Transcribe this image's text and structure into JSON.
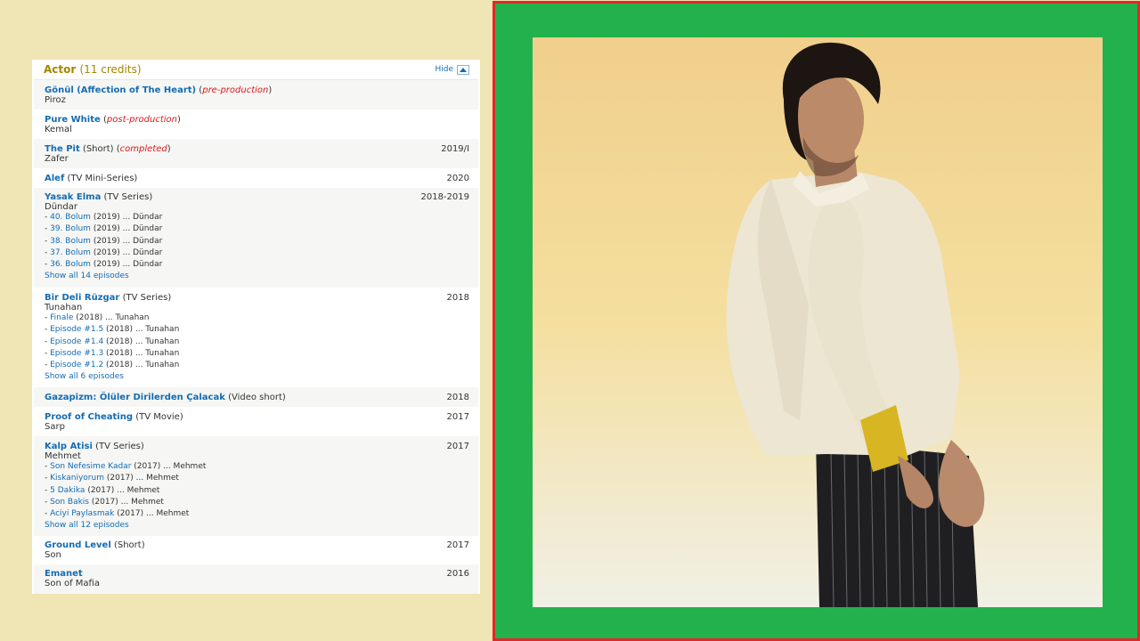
{
  "header": {
    "title": "Actor",
    "count": "(11 credits)",
    "hide_label": "Hide"
  },
  "credits": [
    {
      "title": "Gönül (Affection of The Heart)",
      "type": "",
      "status": "pre-production",
      "year": "",
      "role": "Piroz",
      "episodes": [],
      "show_all": ""
    },
    {
      "title": "Pure White",
      "type": "",
      "status": "post-production",
      "year": "",
      "role": "Kemal",
      "episodes": [],
      "show_all": ""
    },
    {
      "title": "The Pit",
      "type": "(Short)",
      "status": "completed",
      "year": "2019/I",
      "role": "Zafer",
      "episodes": [],
      "show_all": ""
    },
    {
      "title": "Alef",
      "type": "(TV Mini-Series)",
      "status": "",
      "year": "2020",
      "role": "",
      "episodes": [],
      "show_all": ""
    },
    {
      "title": "Yasak Elma",
      "type": "(TV Series)",
      "status": "",
      "year": "2018-2019",
      "role": "Dündar",
      "episodes": [
        {
          "name": "40. Bolum",
          "year": "(2019)",
          "role": "... Dündar"
        },
        {
          "name": "39. Bolum",
          "year": "(2019)",
          "role": "... Dündar"
        },
        {
          "name": "38. Bolum",
          "year": "(2019)",
          "role": "... Dündar"
        },
        {
          "name": "37. Bolum",
          "year": "(2019)",
          "role": "... Dündar"
        },
        {
          "name": "36. Bolum",
          "year": "(2019)",
          "role": "... Dündar"
        }
      ],
      "show_all": "Show all 14 episodes"
    },
    {
      "title": "Bir Deli Rüzgar",
      "type": "(TV Series)",
      "status": "",
      "year": "2018",
      "role": "Tunahan",
      "episodes": [
        {
          "name": "Finale",
          "year": "(2018)",
          "role": "... Tunahan"
        },
        {
          "name": "Episode #1.5",
          "year": "(2018)",
          "role": "... Tunahan"
        },
        {
          "name": "Episode #1.4",
          "year": "(2018)",
          "role": "... Tunahan"
        },
        {
          "name": "Episode #1.3",
          "year": "(2018)",
          "role": "... Tunahan"
        },
        {
          "name": "Episode #1.2",
          "year": "(2018)",
          "role": "... Tunahan"
        }
      ],
      "show_all": "Show all 6 episodes"
    },
    {
      "title": "Gazapizm: Ölüler Dirilerden Çalacak",
      "type": "(Video short)",
      "status": "",
      "year": "2018",
      "role": "",
      "episodes": [],
      "show_all": ""
    },
    {
      "title": "Proof of Cheating",
      "type": "(TV Movie)",
      "status": "",
      "year": "2017",
      "role": "Sarp",
      "episodes": [],
      "show_all": ""
    },
    {
      "title": "Kalp Atisi",
      "type": "(TV Series)",
      "status": "",
      "year": "2017",
      "role": "Mehmet",
      "episodes": [
        {
          "name": "Son Nefesime Kadar",
          "year": "(2017)",
          "role": "... Mehmet"
        },
        {
          "name": "Kiskaniyorum",
          "year": "(2017)",
          "role": "... Mehmet"
        },
        {
          "name": "5 Dakika",
          "year": "(2017)",
          "role": "... Mehmet"
        },
        {
          "name": "Son Bakis",
          "year": "(2017)",
          "role": "... Mehmet"
        },
        {
          "name": "Aciyi Paylasmak",
          "year": "(2017)",
          "role": "... Mehmet"
        }
      ],
      "show_all": "Show all 12 episodes"
    },
    {
      "title": "Ground Level",
      "type": "(Short)",
      "status": "",
      "year": "2017",
      "role": "Son",
      "episodes": [],
      "show_all": ""
    },
    {
      "title": "Emanet",
      "type": "",
      "status": "",
      "year": "2016",
      "role": "Son of Mafia",
      "episodes": [],
      "show_all": ""
    }
  ],
  "colors": {
    "page_bg": "#f0e5b4",
    "frame_green": "#23b14d",
    "frame_red": "#e0282a",
    "link_blue": "#136cb2",
    "status_red": "#d91a1a",
    "header_gold": "#a58500"
  },
  "photo": {
    "icon": "actor-portrait-photo"
  }
}
